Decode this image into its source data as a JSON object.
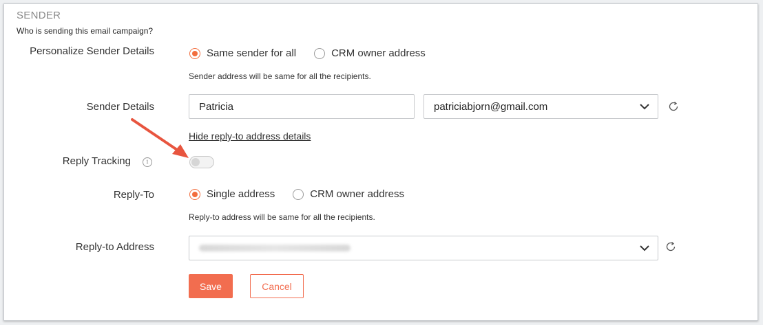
{
  "section": {
    "title": "SENDER",
    "subtitle": "Who is sending this email campaign?"
  },
  "personalize": {
    "label": "Personalize Sender Details",
    "options": [
      {
        "label": "Same sender for all",
        "selected": true
      },
      {
        "label": "CRM owner address",
        "selected": false
      }
    ],
    "hint": "Sender address will be same for all the recipients."
  },
  "sender_details": {
    "label": "Sender Details",
    "name_value": "Patricia",
    "email_value": "patriciabjorn@gmail.com",
    "reply_link": "Hide reply-to address details"
  },
  "reply_tracking": {
    "label": "Reply Tracking",
    "enabled": false,
    "info_icon": "info-icon"
  },
  "reply_to": {
    "label": "Reply-To",
    "options": [
      {
        "label": "Single address",
        "selected": true
      },
      {
        "label": "CRM owner address",
        "selected": false
      }
    ],
    "hint": "Reply-to address will be same for all the recipients."
  },
  "reply_to_address": {
    "label": "Reply-to Address"
  },
  "actions": {
    "save_label": "Save",
    "cancel_label": "Cancel"
  },
  "colors": {
    "accent": "#f26d4f",
    "annotation_arrow": "#e8553f"
  }
}
